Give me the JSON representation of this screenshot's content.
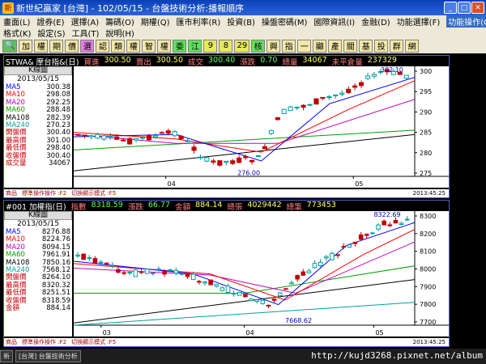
{
  "window": {
    "title": "新世紀贏家 [台灣] - 102/05/15 - 台盤技術分析:播報順序",
    "icon": "app-icon"
  },
  "menu": {
    "row1": [
      "畫面(L)",
      "證券(E)",
      "選擇(A)",
      "籌碼(O)",
      "期權(Q)",
      "匯市利率(R)",
      "投資(B)",
      "操盤密碼(M)",
      "國際資訊(I)",
      "金融(D)",
      "功能選擇(F)"
    ],
    "row1_active": "功能操作(C)",
    "row2": [
      "格式(K)",
      "設定(S)",
      "工具(T)",
      "說明(H)"
    ]
  },
  "toolbar": [
    "加",
    "權",
    "期",
    "價",
    "選",
    "認",
    "類",
    "權",
    "智",
    "權",
    "委",
    "江",
    "9",
    "8",
    "29",
    "核",
    "興",
    "指",
    "一",
    "顯",
    "產",
    "關",
    "基",
    "投",
    "群",
    "網"
  ],
  "panel1": {
    "header": [
      {
        "t": "STWA& 摩台指&(日)",
        "c": "#fff"
      },
      {
        "t": "買進",
        "c": "#ff8080"
      },
      {
        "t": "300.50",
        "c": "#ffff60"
      },
      {
        "t": "賣出",
        "c": "#ff8080"
      },
      {
        "t": "300.50",
        "c": "#ffff60"
      },
      {
        "t": "成交",
        "c": "#ff8080"
      },
      {
        "t": "300.40",
        "c": "#60ff60"
      },
      {
        "t": "漲跌",
        "c": "#ff8080"
      },
      {
        "t": "0.70",
        "c": "#60ff60"
      },
      {
        "t": "總量",
        "c": "#ff8080"
      },
      {
        "t": "34067",
        "c": "#ffff60"
      },
      {
        "t": "未平倉量",
        "c": "#ff8080"
      },
      {
        "t": "237329",
        "c": "#ffff60"
      }
    ],
    "kbtn": "K線圖",
    "date": "2013/05/15",
    "rows": [
      {
        "k": "MA5",
        "v": "300.38",
        "c": "#0000ff"
      },
      {
        "k": "MA10",
        "v": "298.08",
        "c": "#ff0000"
      },
      {
        "k": "MA20",
        "v": "292.25",
        "c": "#c000c0"
      },
      {
        "k": "MA60",
        "v": "288.48",
        "c": "#00a000"
      },
      {
        "k": "MA108",
        "v": "282.39",
        "c": "#000000"
      },
      {
        "k": "MA240",
        "v": "270.23",
        "c": "#00a0a0"
      },
      {
        "k": "開盤價",
        "v": "300.40",
        "c": "#c00000"
      },
      {
        "k": "最高價",
        "v": "301.00",
        "c": "#c00000"
      },
      {
        "k": "最低價",
        "v": "298.40",
        "c": "#c00000"
      },
      {
        "k": "收盤價",
        "v": "300.40",
        "c": "#c00000"
      },
      {
        "k": "成交量",
        "v": "34067",
        "c": "#c00000"
      }
    ],
    "yticks": [
      "300",
      "295",
      "290",
      "285",
      "280",
      "275"
    ],
    "xticks": [
      "04",
      "05"
    ],
    "hi_label": "302.10",
    "lo_label": "276.00",
    "status": [
      "商品",
      "標準操作操作 :F2",
      "切換顯示模式 :F5"
    ],
    "status_right": "2013:45:25"
  },
  "panel2": {
    "header": [
      {
        "t": "#001 加權指(日)",
        "c": "#fff"
      },
      {
        "t": "指數",
        "c": "#ff8080"
      },
      {
        "t": "8318.59",
        "c": "#60ff60"
      },
      {
        "t": "漲跌",
        "c": "#ff8080"
      },
      {
        "t": "66.77",
        "c": "#60ff60"
      },
      {
        "t": "金額",
        "c": "#ff8080"
      },
      {
        "t": "884.14",
        "c": "#ffff60"
      },
      {
        "t": "總張",
        "c": "#ff8080"
      },
      {
        "t": "4029442",
        "c": "#ffff60"
      },
      {
        "t": "總筆",
        "c": "#ff8080"
      },
      {
        "t": "773453",
        "c": "#ffff60"
      }
    ],
    "kbtn": "K線圖",
    "date": "2013/05/15",
    "rows": [
      {
        "k": "MA5",
        "v": "8276.88",
        "c": "#0000ff"
      },
      {
        "k": "MA10",
        "v": "8224.76",
        "c": "#ff0000"
      },
      {
        "k": "MA20",
        "v": "8094.15",
        "c": "#c000c0"
      },
      {
        "k": "MA60",
        "v": "7961.91",
        "c": "#00a000"
      },
      {
        "k": "MA108",
        "v": "7850.16",
        "c": "#000000"
      },
      {
        "k": "MA240",
        "v": "7568.12",
        "c": "#00a0a0"
      },
      {
        "k": "開盤價",
        "v": "8264.10",
        "c": "#c00000"
      },
      {
        "k": "最高價",
        "v": "8320.32",
        "c": "#c00000"
      },
      {
        "k": "最低價",
        "v": "8251.51",
        "c": "#c00000"
      },
      {
        "k": "收盤價",
        "v": "8318.59",
        "c": "#c00000"
      },
      {
        "k": "金額",
        "v": "884.14",
        "c": "#c00000"
      }
    ],
    "yticks": [
      "8300",
      "8200",
      "8100",
      "8000",
      "7900",
      "7800",
      "7700"
    ],
    "xticks": [
      "03",
      "04",
      "05"
    ],
    "hi_label": "8322.69",
    "lo_label": "7668.62",
    "status": [
      "商品",
      "標準操作操作 :F2",
      "切換顯示模式 :F5"
    ],
    "status_right": "2013:45:25"
  },
  "taskbar": {
    "items": [
      "新",
      "[台灣] 台盤技術分析"
    ],
    "url": "http://kujd3268.pixnet.net/album"
  }
}
